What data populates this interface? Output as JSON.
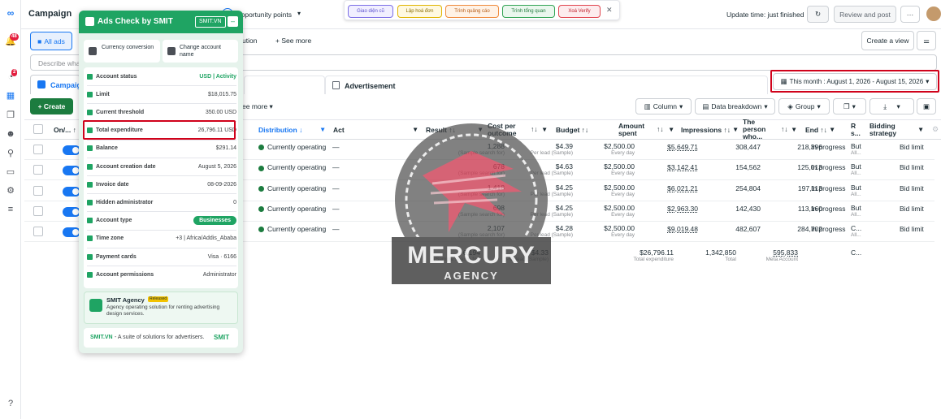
{
  "topbar": {
    "title": "Campaign",
    "opportunity": "Opportunity points",
    "update": "Update time: just finished",
    "review": "Review and post"
  },
  "chips": [
    {
      "label": "Giao diện cũ"
    },
    {
      "label": "Lập hoá đơn"
    },
    {
      "label": "Trình quảng cáo"
    },
    {
      "label": "Trình tổng quan"
    },
    {
      "label": "Xoá Verify"
    }
  ],
  "bar2": {
    "all_ads": "All ads",
    "attribution": "ution",
    "see_more": "See more",
    "create_view": "Create a view"
  },
  "search": {
    "placeholder": "Describe what"
  },
  "tabs": {
    "campaign": "Campaign",
    "advertisement": "Advertisement"
  },
  "date_range": "This month : August 1, 2026 - August 15, 2026",
  "toolbar": {
    "create": "Create",
    "see_more": "ee more",
    "column": "Column",
    "breakdown": "Data breakdown",
    "group": "Group"
  },
  "columns": {
    "onoff": "On/...",
    "distribution": "Distribution",
    "act": "Act",
    "result": "Result",
    "cost": "Cost per outcome",
    "budget": "Budget",
    "amount": "Amount spent",
    "impressions": "Impressions",
    "person": "The person who...",
    "end": "End",
    "rs": "R s...",
    "bidding": "Bidding strategy"
  },
  "rows": [
    {
      "status": "Currently operating",
      "act": "—",
      "result": "1,288",
      "result_sub": "(Sample search for)",
      "cost": "$4.39",
      "cost_sub": "Per lead (Sample)",
      "budget": "$2,500.00",
      "budget_sub": "Every day",
      "amount": "$5,649.71",
      "impressions": "308,447",
      "reach": "218,396",
      "end": "In progress",
      "rs": "But",
      "rs_sub": "All...",
      "bid": "Bid limit"
    },
    {
      "status": "Currently operating",
      "act": "—",
      "result": "678",
      "result_sub": "(Sample search for)",
      "cost": "$4.63",
      "cost_sub": "Per lead (Sample)",
      "budget": "$2,500.00",
      "budget_sub": "Every day",
      "amount": "$3,142.41",
      "impressions": "154,562",
      "reach": "125,013",
      "end": "In progress",
      "rs": "But",
      "rs_sub": "All...",
      "bid": "Bid limit"
    },
    {
      "status": "Currently operating",
      "act": "—",
      "result": "1,418",
      "result_sub": "(Sample search for)",
      "cost": "$4.25",
      "cost_sub": "Per lead (Sample)",
      "budget": "$2,500.00",
      "budget_sub": "Every day",
      "amount": "$6,021.21",
      "impressions": "254,804",
      "reach": "197,113",
      "end": "In progress",
      "rs": "But",
      "rs_sub": "All...",
      "bid": "Bid limit"
    },
    {
      "status": "Currently operating",
      "act": "—",
      "result": "698",
      "result_sub": "(Sample search for)",
      "cost": "$4.25",
      "cost_sub": "Per lead (Sample)",
      "budget": "$2,500.00",
      "budget_sub": "Every day",
      "amount": "$2,963.30",
      "impressions": "142,430",
      "reach": "113,160",
      "end": "In progress",
      "rs": "But",
      "rs_sub": "All...",
      "bid": "Bid limit"
    },
    {
      "status": "Currently operating",
      "act": "—",
      "result": "2,107",
      "result_sub": "(Sample search for)",
      "cost": "$4.28",
      "cost_sub": "Per lead (Sample)",
      "budget": "$2,500.00",
      "budget_sub": "Every day",
      "amount": "$9,019.48",
      "impressions": "482,607",
      "reach": "284,702",
      "end": "In progress",
      "rs": "C...",
      "rs_sub": "All...",
      "bid": "Bid limit"
    }
  ],
  "totals": {
    "result": "6,194",
    "result_sub": "(Sample search for)",
    "cost": "$4.33",
    "cost_sub": "Per lead (Sample)",
    "amount": "$26,796.11",
    "amount_sub": "Total expenditure",
    "impressions": "1,342,850",
    "impressions_sub": "Total",
    "reach": "595,833",
    "reach_sub": "Meta Account",
    "rs": "C..."
  },
  "panel": {
    "title": "Ads Check by SMIT",
    "badge": "SMIT.VN",
    "currency": "Currency conversion",
    "change_name": "Change account name",
    "fields": [
      {
        "label": "Account status",
        "value": "USD | Activity"
      },
      {
        "label": "Limit",
        "value": "$18,015.75"
      },
      {
        "label": "Current threshold",
        "value": "350.00 USD"
      },
      {
        "label": "Total expenditure",
        "value": "26,796.11 USD"
      },
      {
        "label": "Balance",
        "value": "$291.14"
      },
      {
        "label": "Account creation date",
        "value": "August 5, 2026"
      },
      {
        "label": "Invoice date",
        "value": "08-09-2026"
      },
      {
        "label": "Hidden administrator",
        "value": "0"
      },
      {
        "label": "Account type",
        "value": "Businesses"
      },
      {
        "label": "Time zone",
        "value": "+3 | Africa/Addis_Ababa"
      },
      {
        "label": "Payment cards",
        "value": "Visa · 6166"
      },
      {
        "label": "Account permissions",
        "value": "Administrator"
      }
    ],
    "agency_title": "SMIT Agency",
    "agency_badge": "Released",
    "agency_desc": "Agency operating solution for renting advertising design services.",
    "footer_link": "SMIT.VN",
    "footer_text": " - A suite of solutions for advertisers.",
    "footer_logo": "SMIT"
  },
  "watermark": {
    "line1": "MERCURY",
    "line2": "AGENCY"
  },
  "colors": {
    "accent": "#1877f2",
    "smit_green": "#1fa463",
    "highlight": "#d0021b"
  }
}
